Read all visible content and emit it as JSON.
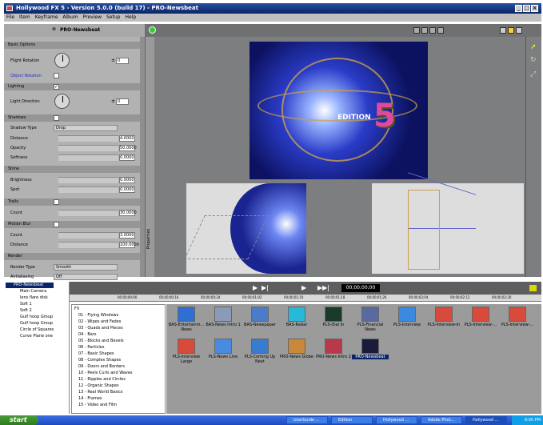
{
  "window": {
    "title": "Hollywood FX 5 - Version 5.0.0 (build 17) - PRO-Newsbeat"
  },
  "menu": [
    "File",
    "Item",
    "Keyframe",
    "Album",
    "Preview",
    "Setup",
    "Help"
  ],
  "panel": {
    "title": "PRO-Newsbeat",
    "basic_options": "Basic Options",
    "flight_rotation": "Flight Rotation",
    "flight_rotation_val": "0",
    "object_rotation": "Object Rotation",
    "lighting": "Lighting",
    "light_direction": "Light Direction",
    "light_direction_val": "0",
    "shadows": "Shadows",
    "shadow_type": "Shadow Type",
    "shadow_type_val": "Drop",
    "distance": "Distance",
    "distance_val": "4.0000",
    "opacity": "Opacity",
    "opacity_val": "50.0000",
    "softness": "Softness",
    "softness_val": "0.0000",
    "shine": "Shine",
    "brightness": "Brightness",
    "brightness_val": "0.0000",
    "spot": "Spot",
    "spot_val": "0.0000",
    "trails": "Trails",
    "count": "Count",
    "trails_count_val": "30.0000",
    "motion_blur": "Motion Blur",
    "mb_count_val": "3.0000",
    "mb_distance_val": "100.0000",
    "render": "Render",
    "render_type": "Render Type",
    "render_type_val": "Smooth",
    "antialiasing": "Antialiasing",
    "antialiasing_val": "Off",
    "properties_tab": "Properties"
  },
  "viewport": {
    "main_text": "EDITION",
    "main_number": "5"
  },
  "timeline": {
    "timecode": "00;00;00;00",
    "ticks": [
      "00;00;00;00",
      "00;00;00;16",
      "00;00;00;24",
      "00;00;01;02",
      "00;00;01;10",
      "00;00;01;18",
      "00;00;01;26",
      "00;00;02;04",
      "00;00;02;12",
      "00;00;02;20"
    ]
  },
  "tree": {
    "root": "PRO-Newsbeat",
    "items": [
      "Main Camera",
      "lens flare disk",
      "Soft 1",
      "Soft 2",
      "Gulf hoop Group",
      "Gulf hoop Group",
      "Circle of Squares",
      "Curve Plane one"
    ]
  },
  "fx_list": {
    "root": "FX",
    "items": [
      "01 - Flying Windows",
      "02 - Wipes and Fades",
      "03 - Quads and Pieces",
      "04 - Bars",
      "05 - Blocks and Bevels",
      "06 - Particles",
      "07 - Basic Shapes",
      "08 - Complex Shapes",
      "09 - Doors and Borders",
      "10 - Peels Curls and Waves",
      "11 - Ripples and Circles",
      "12 - Organic Shapes",
      "13 - Real World Basics",
      "14 - Frames",
      "15 - Video and Film"
    ]
  },
  "thumbs": [
    {
      "label": "BAS-Entertainm... News",
      "color": "#2f6fd0"
    },
    {
      "label": "BAS-News Intro 1",
      "color": "#8a9ab8"
    },
    {
      "label": "BAS-Newspaper",
      "color": "#4a7cc8"
    },
    {
      "label": "BAS-Radar",
      "color": "#28b8d8"
    },
    {
      "label": "PLS-Dial In",
      "color": "#1a3a2a"
    },
    {
      "label": "PLS-Financial News",
      "color": "#5a6aa0"
    },
    {
      "label": "PLS-Interview",
      "color": "#3b8ae0"
    },
    {
      "label": "PLS-Interview-In",
      "color": "#d84a3a"
    },
    {
      "label": "PLS-Interview-...",
      "color": "#d84a3a"
    },
    {
      "label": "PLS-Interview-...",
      "color": "#d84a3a"
    },
    {
      "label": "PLS-Interview Large",
      "color": "#d84a3a"
    },
    {
      "label": "PLS-News Line",
      "color": "#4a8ae0"
    },
    {
      "label": "PLS-Coming Up Next",
      "color": "#3a7ad0"
    },
    {
      "label": "PRO-News Globe",
      "color": "#c88a3a"
    },
    {
      "label": "PRO-News Intro 2",
      "color": "#b83a4a"
    },
    {
      "label": "PRO-Newsbeat",
      "color": "#1a1a3a"
    }
  ],
  "taskbar": {
    "start": "start",
    "buttons": [
      "UserGuide ...",
      "Edition",
      "Hollywood ...",
      "Adobe Phot...",
      "Hollywood ..."
    ],
    "clock": "9:00 PM"
  }
}
